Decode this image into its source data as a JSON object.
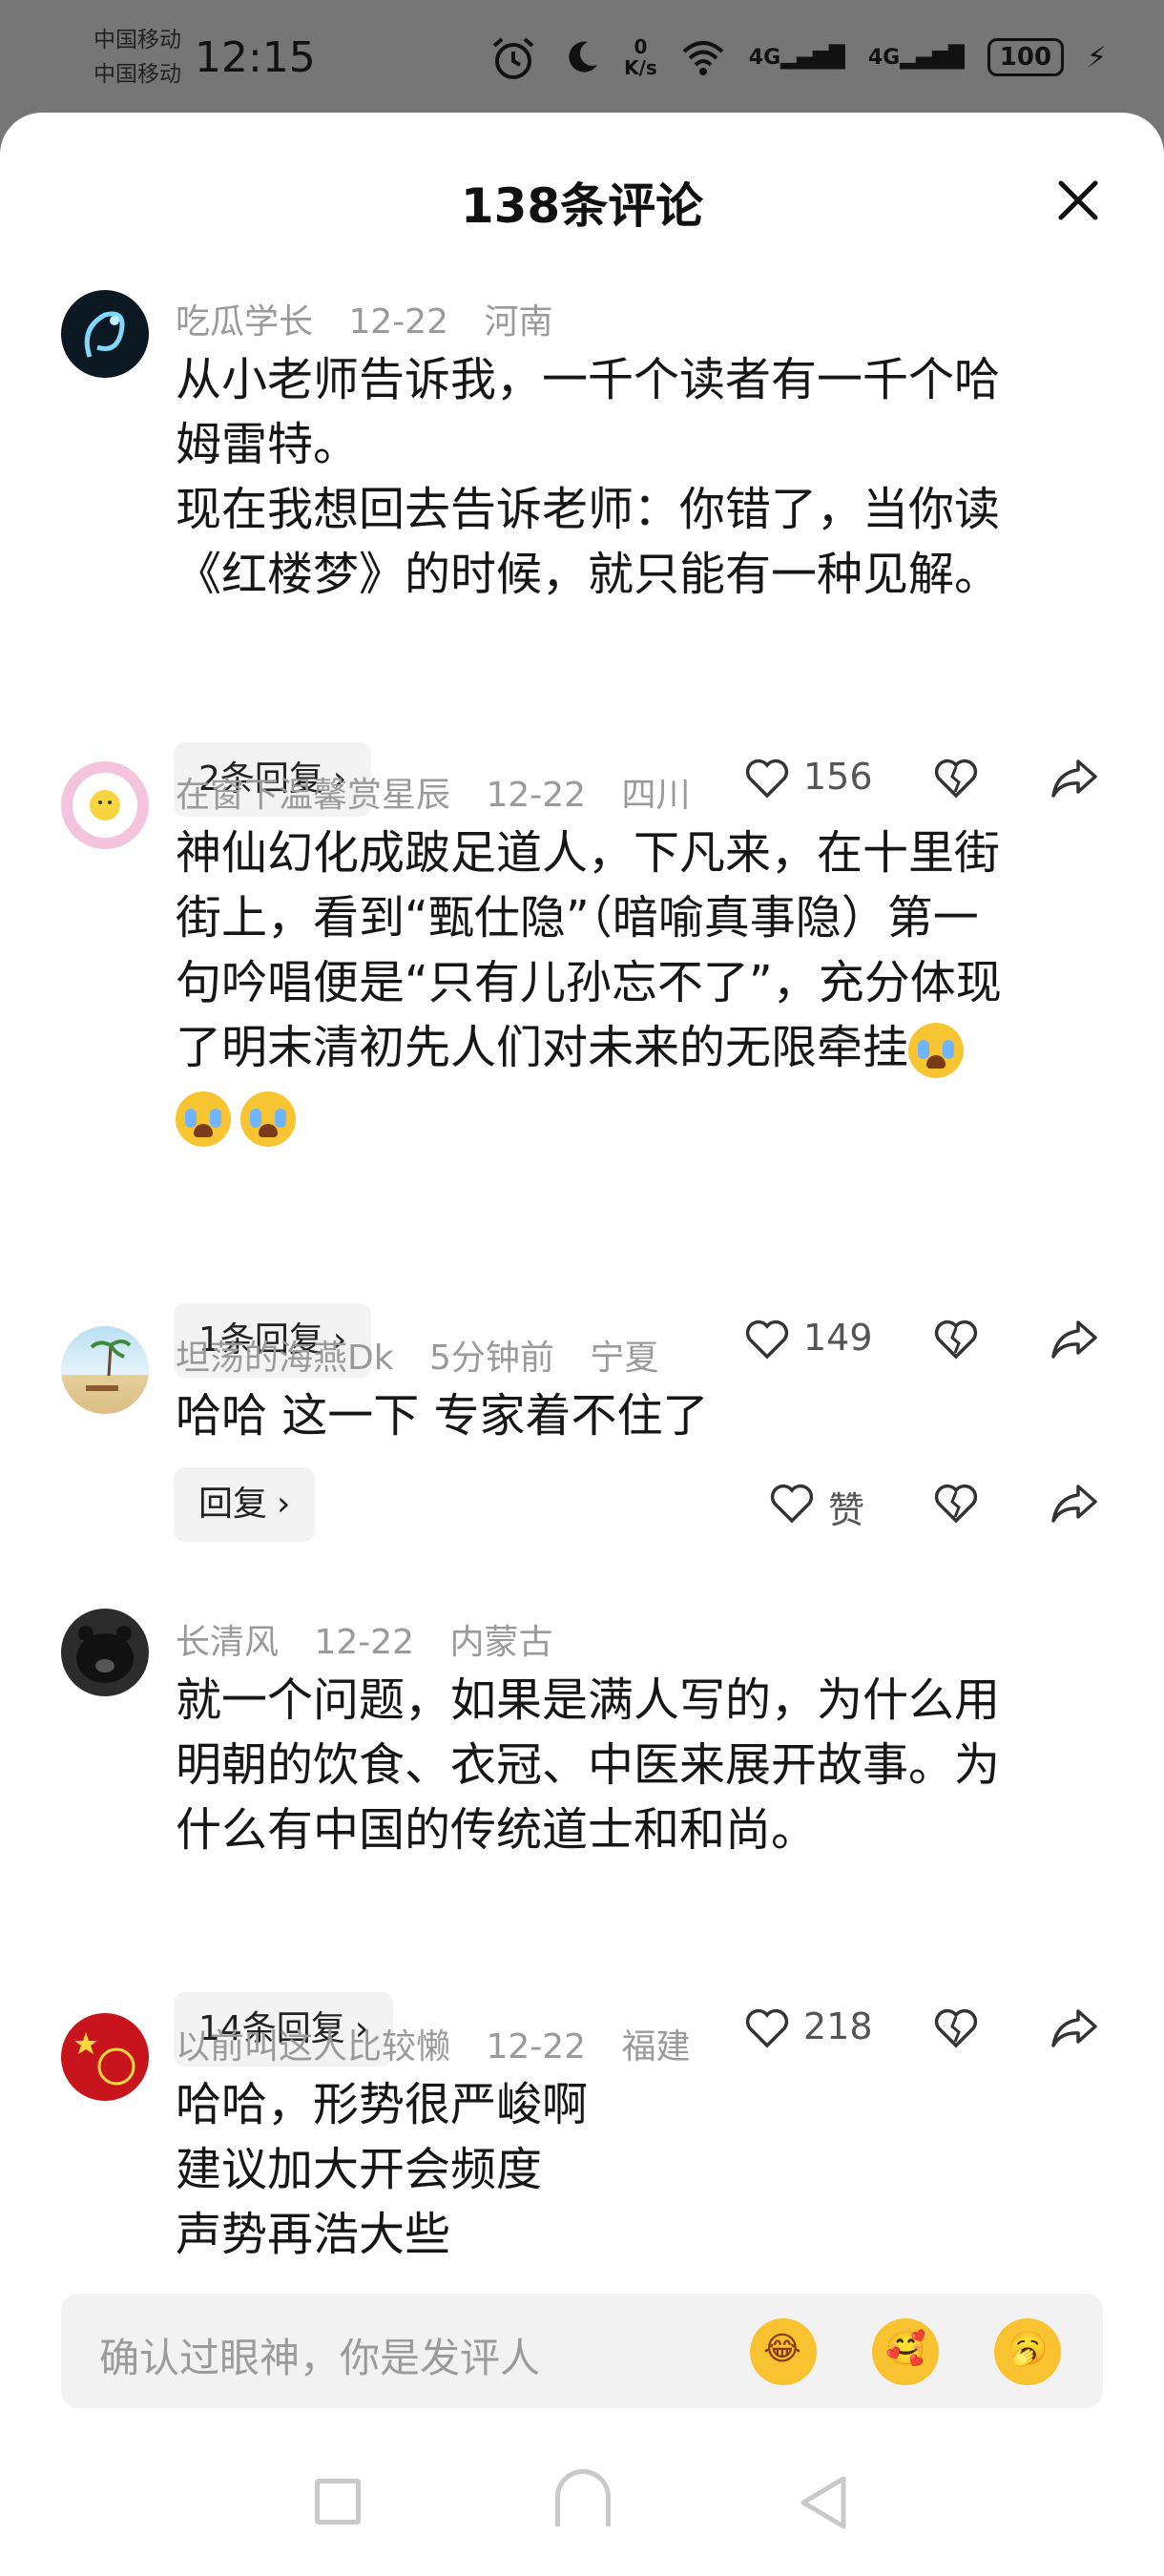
{
  "status_bar": {
    "carrier1": "中国移动",
    "carrier2": "中国移动",
    "time": "12:15",
    "net_speed_value": "0",
    "net_speed_unit": "K/s",
    "signal1": "4G",
    "signal2": "4G",
    "battery": "100"
  },
  "sheet": {
    "title": "138条评论"
  },
  "comments": [
    {
      "user": "吃瓜学长",
      "date": "12-22",
      "region": "河南",
      "lines": [
        "从小老师告诉我，一千个读者有一千个哈",
        "姆雷特。",
        "现在我想回去告诉老师：你错了，当你读",
        "《红楼梦》的时候，就只能有一种见解。"
      ],
      "reply_label": "2条回复",
      "likes": "156"
    },
    {
      "user": "在窗下温馨赏星辰",
      "date": "12-22",
      "region": "四川",
      "lines": [
        "神仙幻化成跛足道人，下凡来，在十里街",
        "街上，看到“甄仕隐”（暗喻真事隐）第一",
        "句吟唱便是“只有儿孙忘不了”，充分体现",
        "了明末清初先人们对未来的无限牵挂"
      ],
      "reply_label": "1条回复",
      "likes": "149"
    },
    {
      "user": "坦荡的海燕Dk",
      "date": "5分钟前",
      "region": "宁夏",
      "lines": [
        "哈哈 这一下 专家着不住了"
      ],
      "reply_label": "回复",
      "likes": "赞"
    },
    {
      "user": "长清风",
      "date": "12-22",
      "region": "内蒙古",
      "lines": [
        "就一个问题，如果是满人写的，为什么用",
        "明朝的饮食、衣冠、中医来展开故事。为",
        "什么有中国的传统道士和和尚。"
      ],
      "reply_label": "14条回复",
      "likes": "218"
    },
    {
      "user": "以前叫这人比较懒",
      "date": "12-22",
      "region": "福建",
      "lines": [
        "哈哈，形势很严峻啊",
        "建议加大开会频度",
        "声势再浩大些"
      ]
    }
  ],
  "input": {
    "placeholder": "确认过眼神，你是发评人"
  },
  "icons": {
    "close": "close-icon",
    "like": "heart-icon",
    "dislike": "broken-heart-icon",
    "share": "share-arrow-icon"
  },
  "colors": {
    "meta_text": "#9a9a9a",
    "pill_bg": "#f3f3f3",
    "input_bg": "#f2f2f2"
  }
}
